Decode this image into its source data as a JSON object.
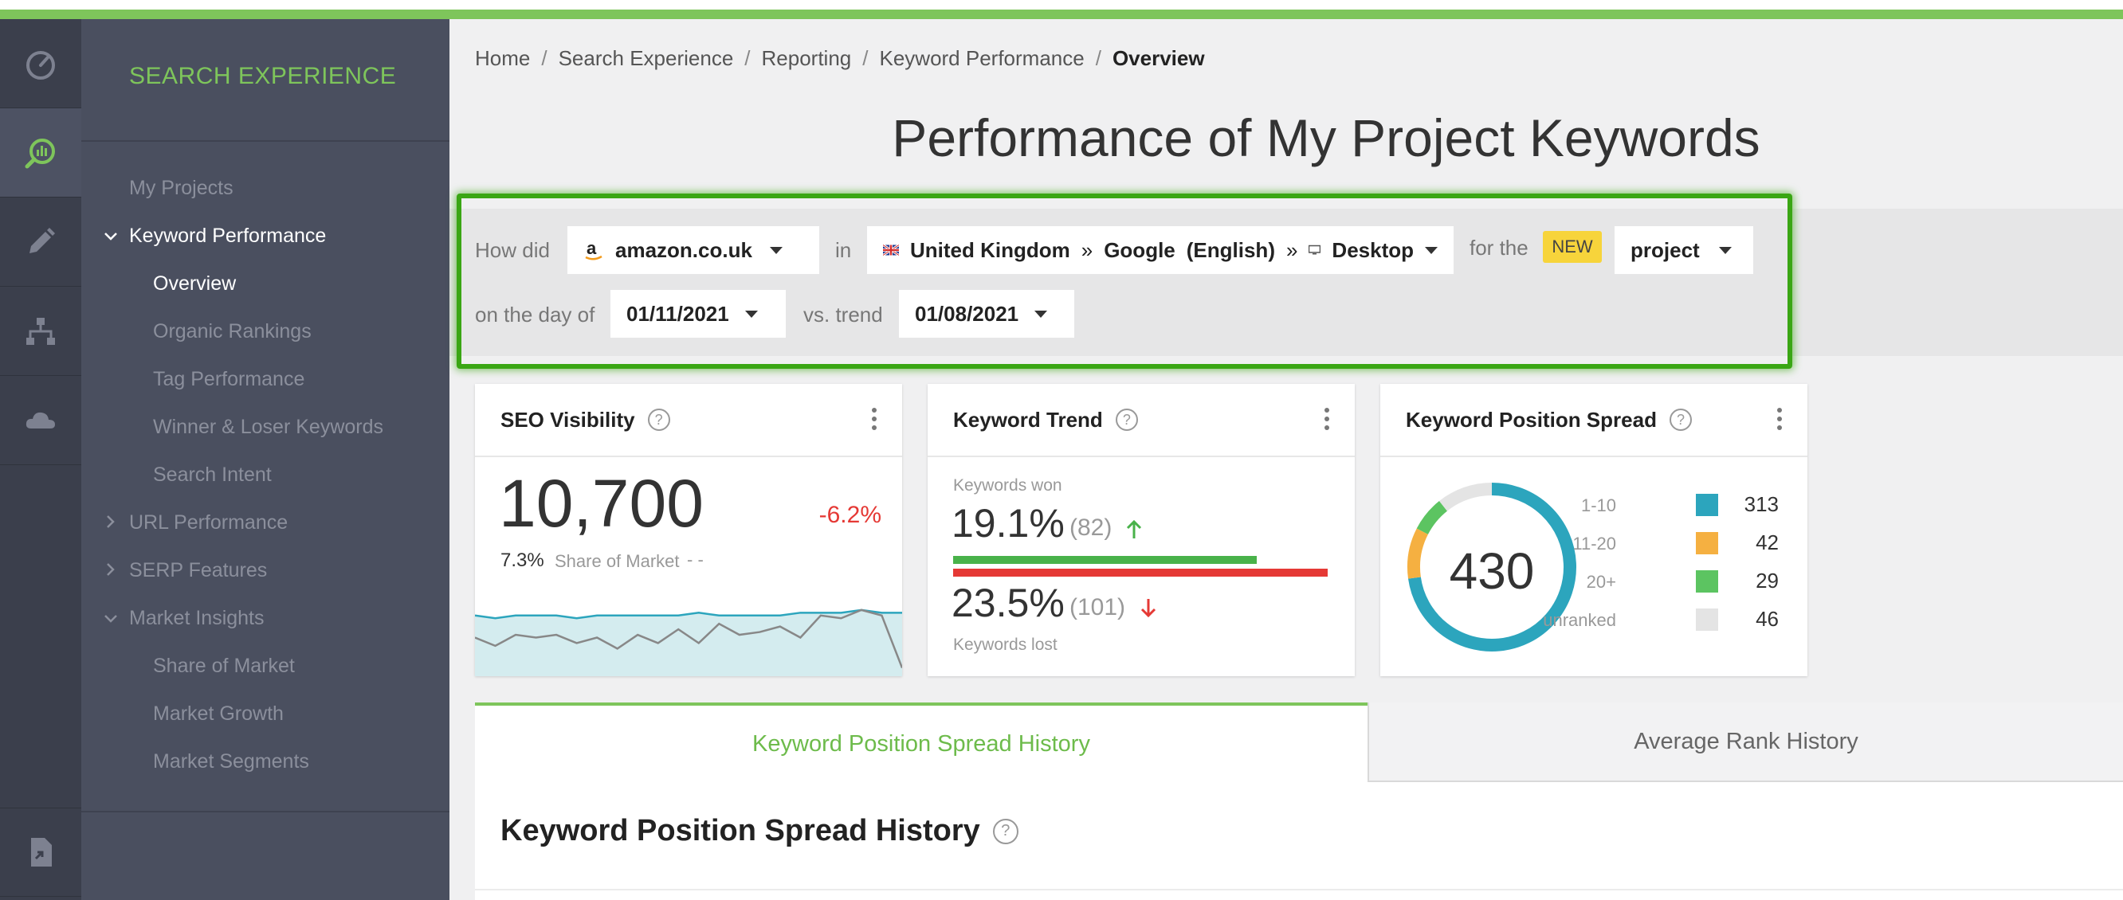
{
  "sidebar": {
    "brand": "SEARCH EXPERIENCE",
    "items": [
      {
        "label": "My Projects"
      },
      {
        "label": "Keyword Performance"
      },
      {
        "label": "Overview"
      },
      {
        "label": "Organic Rankings"
      },
      {
        "label": "Tag Performance"
      },
      {
        "label": "Winner & Loser Keywords"
      },
      {
        "label": "Search Intent"
      },
      {
        "label": "URL Performance"
      },
      {
        "label": "SERP Features"
      },
      {
        "label": "Market Insights"
      },
      {
        "label": "Share of Market"
      },
      {
        "label": "Market Growth"
      },
      {
        "label": "Market Segments"
      }
    ]
  },
  "rail_icons": [
    "dashboard-gauge-icon",
    "search-analytics-icon",
    "pencil-icon",
    "sitemap-icon",
    "cloud-icon",
    "report-file-icon"
  ],
  "breadcrumb": [
    "Home",
    "Search Experience",
    "Reporting",
    "Keyword Performance",
    "Overview"
  ],
  "page_title": "Performance of My Project Keywords",
  "filters": {
    "how_did": "How did",
    "domain": "amazon.co.uk",
    "in": "in",
    "country": "United Kingdom",
    "sep1": "»",
    "engine": "Google",
    "language": "(English)",
    "sep2": "»",
    "device": "Desktop",
    "for_the": "for the",
    "new_badge": "NEW",
    "scope": "project",
    "on_the_day_of": "on the day of",
    "date": "01/11/2021",
    "vs_trend": "vs. trend",
    "trend_date": "01/08/2021"
  },
  "seo_visibility": {
    "title": "SEO Visibility",
    "value": "10,700",
    "change": "-6.2%",
    "share_value": "7.3%",
    "share_label": "Share of Market",
    "share_trend": "- -",
    "sparkline_visibility": [
      10.6,
      10.5,
      10.6,
      10.6,
      10.6,
      10.5,
      10.6,
      10.6,
      10.6,
      10.6,
      10.6,
      10.7,
      10.6,
      10.6,
      10.6,
      10.6,
      10.7,
      10.7,
      10.7,
      10.8,
      10.7,
      10.7
    ],
    "sparkline_share": [
      9.8,
      9.5,
      9.9,
      9.8,
      9.9,
      9.6,
      9.8,
      9.4,
      9.9,
      9.6,
      10.1,
      9.6,
      10.3,
      9.9,
      10.0,
      10.2,
      9.8,
      10.6,
      10.5,
      10.8,
      10.6,
      8.7
    ]
  },
  "keyword_trend": {
    "title": "Keyword Trend",
    "won_label": "Keywords won",
    "won_pct": "19.1%",
    "won_count": "(82)",
    "lost_pct": "23.5%",
    "lost_count": "(101)",
    "lost_label": "Keywords lost",
    "won_fraction": 0.81,
    "lost_fraction": 1.0,
    "won_color": "#49b24a",
    "lost_color": "#e53935"
  },
  "position_spread": {
    "title": "Keyword Position Spread",
    "total": "430",
    "legend": [
      {
        "label": "1-10",
        "value": "313",
        "color": "#2ca5bd"
      },
      {
        "label": "11-20",
        "value": "42",
        "color": "#f5b041"
      },
      {
        "label": "20+",
        "value": "29",
        "color": "#5cc461"
      },
      {
        "label": "unranked",
        "value": "46",
        "color": "#e4e4e4"
      }
    ]
  },
  "tabs": {
    "active": "Keyword Position Spread History",
    "inactive": "Average Rank History"
  },
  "section_title": "Keyword Position Spread History",
  "help_glyph": "?"
}
